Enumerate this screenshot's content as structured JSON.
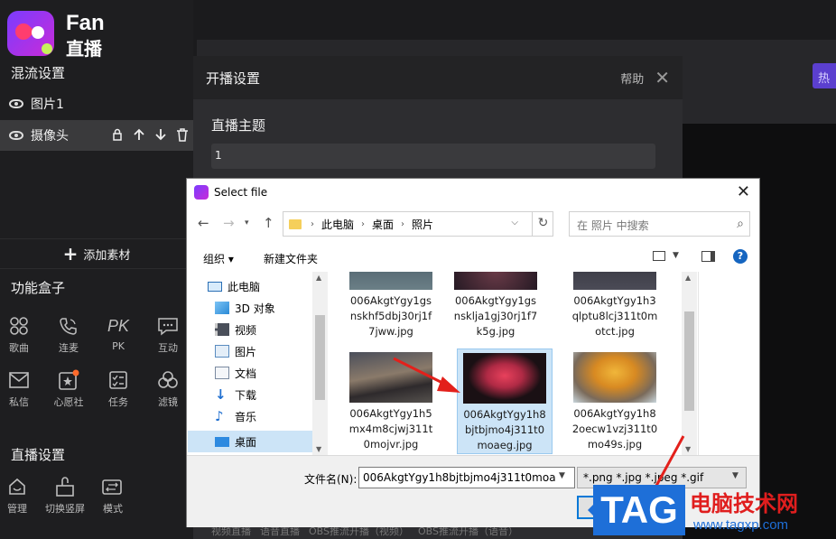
{
  "app": {
    "brand_line1": "Fan",
    "brand_line2": "直播",
    "colors": {
      "accent": "#7a3cff",
      "brand_pink": "#ff3d6e"
    }
  },
  "sidebar": {
    "mix_title": "混流设置",
    "layers": [
      {
        "label": "图片1"
      },
      {
        "label": "摄像头",
        "tools": [
          "lock-icon",
          "arrow-up-icon",
          "arrow-down-icon",
          "trash-icon"
        ]
      }
    ],
    "add_material_label": "添加素材",
    "function_box_title": "功能盒子",
    "tools_row1": [
      {
        "label": "歌曲",
        "icon": "grid-icon"
      },
      {
        "label": "连麦",
        "icon": "phone-icon"
      },
      {
        "label": "PK",
        "icon": "pk-icon"
      },
      {
        "label": "互动",
        "icon": "chat-icon"
      }
    ],
    "tools_row2": [
      {
        "label": "私信",
        "icon": "mail-icon"
      },
      {
        "label": "心愿社",
        "icon": "star-box-icon"
      },
      {
        "label": "任务",
        "icon": "checklist-icon"
      },
      {
        "label": "滤镜",
        "icon": "filter-icon"
      }
    ],
    "live_settings_title": "直播设置",
    "tools_row3": [
      {
        "label": "管理",
        "icon": "home-icon"
      },
      {
        "label": "切换竖屏",
        "icon": "rotate-icon"
      },
      {
        "label": "模式",
        "icon": "mode-icon"
      }
    ]
  },
  "main": {
    "hot_button_label": "热"
  },
  "live_panel": {
    "title": "开播设置",
    "help": "帮助",
    "topic_label": "直播主题",
    "topic_value": "1",
    "modes": [
      "视频直播",
      "语音直播",
      "OBS推流开播（视频）",
      "OBS推流开播（语音）"
    ]
  },
  "dialog": {
    "title": "Select file",
    "breadcrumb": [
      "此电脑",
      "桌面",
      "照片"
    ],
    "search_placeholder": "在 照片 中搜索",
    "organize_label": "组织",
    "new_folder_label": "新建文件夹",
    "tree": [
      {
        "label": "此电脑",
        "icon": "computer-icon"
      },
      {
        "label": "3D 对象",
        "icon": "cube-icon"
      },
      {
        "label": "视频",
        "icon": "video-icon"
      },
      {
        "label": "图片",
        "icon": "picture-icon"
      },
      {
        "label": "文档",
        "icon": "document-icon"
      },
      {
        "label": "下载",
        "icon": "download-icon"
      },
      {
        "label": "音乐",
        "icon": "music-icon"
      },
      {
        "label": "桌面",
        "icon": "desktop-icon",
        "selected": true
      }
    ],
    "files": [
      {
        "name": "006AkgtYgy1gsnskhf5dbj30rj1f7jww.jpg",
        "lines": [
          "006AkgtYgy1gs",
          "nskhf5dbj30rj1f",
          "7jww.jpg"
        ]
      },
      {
        "name": "006AkgtYgy1gsnsklja1gj30rj1f7k5g.jpg",
        "lines": [
          "006AkgtYgy1gs",
          "nsklja1gj30rj1f7",
          "k5g.jpg"
        ]
      },
      {
        "name": "006AkgtYgy1h3qlptu8lcj311t0motct.jpg",
        "lines": [
          "006AkgtYgy1h3",
          "qlptu8lcj311t0m",
          "otct.jpg"
        ]
      },
      {
        "name": "006AkgtYgy1h5mx4m8cjwj311t0mojvr.jpg",
        "lines": [
          "006AkgtYgy1h5",
          "mx4m8cjwj311t",
          "0mojvr.jpg"
        ]
      },
      {
        "name": "006AkgtYgy1h8bjtbjmo4j311t0moaeg.jpg",
        "lines": [
          "006AkgtYgy1h8",
          "bjtbjmo4j311t0",
          "moaeg.jpg"
        ],
        "selected": true
      },
      {
        "name": "006AkgtYgy1h82oecw1vzj311t0mo49s.jpg",
        "lines": [
          "006AkgtYgy1h8",
          "2oecw1vzj311t0",
          "mo49s.jpg"
        ]
      }
    ],
    "filename_label": "文件名(N):",
    "filename_value": "006AkgtYgy1h8bjtbjmo4j311t0moa",
    "filetype_value": "*.png *.jpg *.jpeg *.gif"
  },
  "watermark": {
    "tag": "TAG",
    "chinese": "电脑技术网",
    "url": "www.tagxp.com"
  }
}
